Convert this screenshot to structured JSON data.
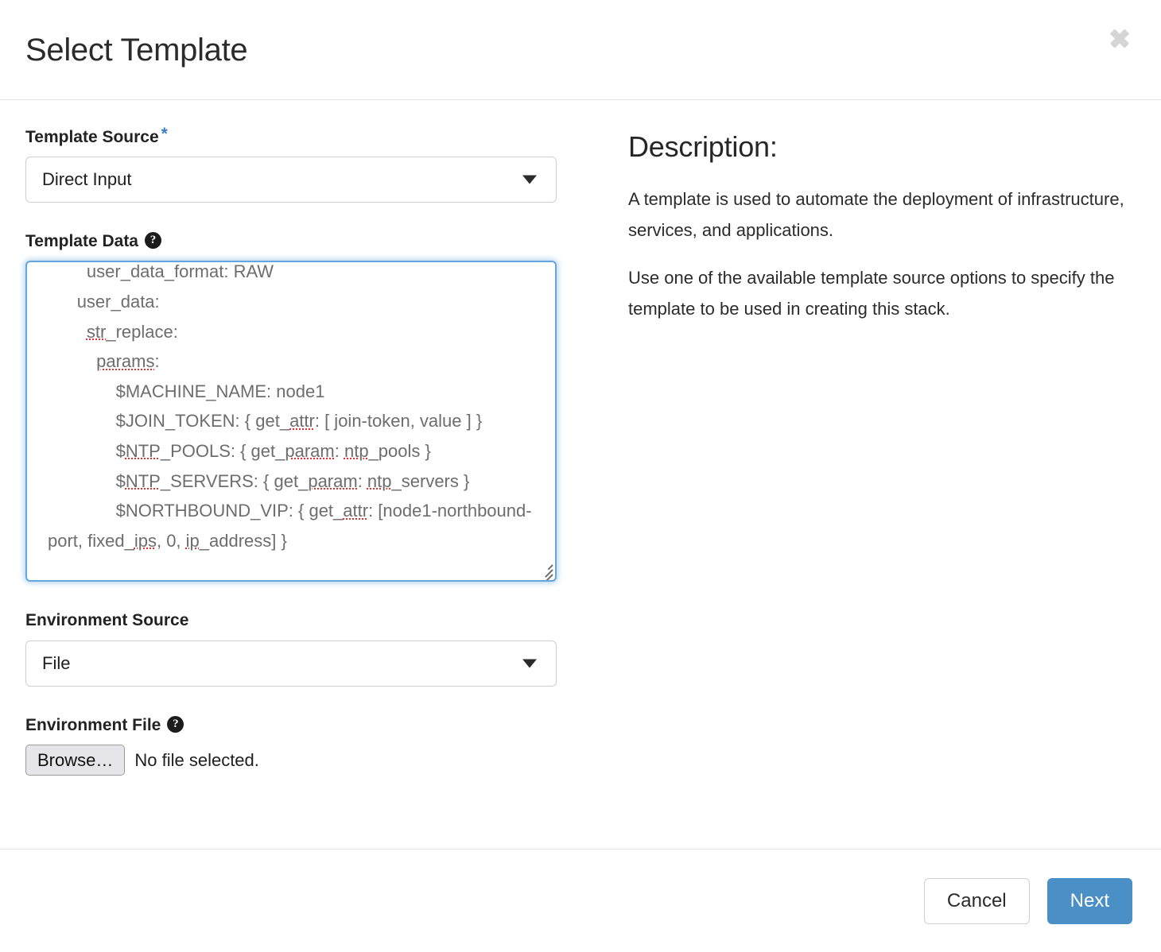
{
  "dialog": {
    "title": "Select Template",
    "close_icon": "close-icon",
    "close_label": "✖"
  },
  "form": {
    "template_source": {
      "label": "Template Source",
      "required_marker": "*",
      "value": "Direct Input",
      "options": [
        "Direct Input"
      ]
    },
    "template_data": {
      "label": "Template Data",
      "help_icon": "help-icon",
      "help_glyph": "?",
      "lines": [
        {
          "indent": 4,
          "segments": [
            {
              "t": "user_data_format: RAW"
            }
          ]
        },
        {
          "indent": 3,
          "segments": [
            {
              "t": "user_data:"
            }
          ]
        },
        {
          "indent": 4,
          "segments": [
            {
              "t": "str",
              "sp": true
            },
            {
              "t": "_replace:"
            }
          ]
        },
        {
          "indent": 5,
          "segments": [
            {
              "t": "params",
              "sp": true
            },
            {
              "t": ":"
            }
          ]
        },
        {
          "indent": 7,
          "segments": [
            {
              "t": "$MACHINE_NAME: node1"
            }
          ]
        },
        {
          "indent": 7,
          "segments": [
            {
              "t": "$JOIN_TOKEN: { get_",
              "sp": false
            },
            {
              "t": "attr",
              "sp": true
            },
            {
              "t": ": [ join-token, value ] }"
            }
          ]
        },
        {
          "indent": 7,
          "segments": [
            {
              "t": "$"
            },
            {
              "t": "NTP",
              "sp": true
            },
            {
              "t": "_POOLS: { get_"
            },
            {
              "t": "param",
              "sp": true
            },
            {
              "t": ": "
            },
            {
              "t": "ntp",
              "sp": true
            },
            {
              "t": "_pools }"
            }
          ]
        },
        {
          "indent": 7,
          "segments": [
            {
              "t": "$"
            },
            {
              "t": "NTP",
              "sp": true
            },
            {
              "t": "_SERVERS: { get_"
            },
            {
              "t": "param",
              "sp": true
            },
            {
              "t": ": "
            },
            {
              "t": "ntp",
              "sp": true
            },
            {
              "t": "_servers }"
            }
          ]
        },
        {
          "indent": 7,
          "segments": [
            {
              "t": "$NORTHBOUND_VIP: { get_"
            },
            {
              "t": "attr",
              "sp": true
            },
            {
              "t": ": [node1-northbound-port, fixed_"
            },
            {
              "t": "ips",
              "sp": true
            },
            {
              "t": ", 0, "
            },
            {
              "t": "ip",
              "sp": true
            },
            {
              "t": "_address] }"
            }
          ]
        }
      ],
      "raw_value": "    user_data_format: RAW\n   user_data:\n    str_replace:\n     params:\n       $MACHINE_NAME: node1\n       $JOIN_TOKEN: { get_attr: [ join-token, value ] }\n       $NTP_POOLS: { get_param: ntp_pools }\n       $NTP_SERVERS: { get_param: ntp_servers }\n       $NORTHBOUND_VIP: { get_attr: [node1-northbound-port, fixed_ips, 0, ip_address] }",
      "resize_handle": "resize-handle"
    },
    "environment_source": {
      "label": "Environment Source",
      "value": "File",
      "options": [
        "File"
      ]
    },
    "environment_file": {
      "label": "Environment File",
      "help_icon": "help-icon",
      "help_glyph": "?",
      "browse_label": "Browse…",
      "status": "No file selected."
    }
  },
  "description": {
    "heading": "Description:",
    "paragraphs": [
      "A template is used to automate the deployment of infrastructure, services, and applications.",
      "Use one of the available template source options to specify the template to be used in creating this stack."
    ]
  },
  "footer": {
    "cancel_label": "Cancel",
    "next_label": "Next"
  },
  "colors": {
    "accent_blue": "#4a90c7",
    "required_star": "#3b7dc0",
    "focus_border": "#64a6dd",
    "textarea_text": "#6d6d6d",
    "spellcheck_underline": "#e03131"
  }
}
